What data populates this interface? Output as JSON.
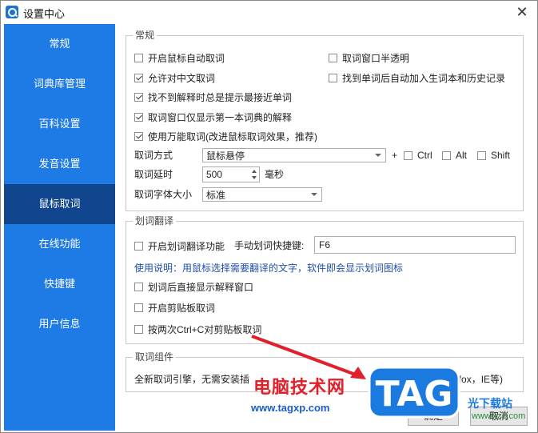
{
  "window": {
    "title": "设置中心",
    "close_glyph": "✕"
  },
  "sidebar": {
    "items": [
      {
        "label": "常规"
      },
      {
        "label": "词典库管理"
      },
      {
        "label": "百科设置"
      },
      {
        "label": "发音设置"
      },
      {
        "label": "鼠标取词",
        "active": true
      },
      {
        "label": "在线功能"
      },
      {
        "label": "快捷键"
      },
      {
        "label": "用户信息"
      }
    ]
  },
  "general": {
    "title": "常规",
    "opt_auto_pick": {
      "label": "开启鼠标自动取词",
      "checked": false
    },
    "opt_translucent": {
      "label": "取词窗口半透明",
      "checked": false
    },
    "opt_chinese": {
      "label": "允许对中文取词",
      "checked": true
    },
    "opt_add_history": {
      "label": "找到单词后自动加入生词本和历史记录",
      "checked": false
    },
    "opt_nearest": {
      "label": "找不到解释时总是提示最接近单词",
      "checked": true
    },
    "opt_first_dict": {
      "label": "取词窗口仅显示第一本词典的解释",
      "checked": true
    },
    "opt_universal": {
      "label": "使用万能取词(改进鼠标取词效果，推荐)",
      "checked": true
    },
    "mode_label": "取词方式",
    "mode_value": "鼠标悬停",
    "plus": "+",
    "ctrl": {
      "label": "Ctrl",
      "checked": false
    },
    "alt": {
      "label": "Alt",
      "checked": false
    },
    "shift": {
      "label": "Shift",
      "checked": false
    },
    "delay_label": "取词延时",
    "delay_value": "500",
    "delay_unit": "毫秒",
    "font_label": "取词字体大小",
    "font_value": "标准"
  },
  "translate": {
    "title": "划词翻译",
    "opt_enable": {
      "label": "开启划词翻译功能",
      "checked": false
    },
    "hotkey_label": "手动划词快捷键:",
    "hotkey_value": "F6",
    "note": "使用说明：用鼠标选择需要翻译的文字，软件即会显示划词图标",
    "opt_direct": {
      "label": "划词后直接显示解释窗口",
      "checked": false
    },
    "opt_clipboard": {
      "label": "开启剪贴板取词",
      "checked": false
    },
    "opt_ctrlc": {
      "label": "按两次Ctrl+C对剪贴板取词",
      "checked": false
    }
  },
  "component": {
    "title": "取词组件",
    "desc_left": "全新取词引擎，无需安装插",
    "desc_right": "hrome、Firefox，IE等)"
  },
  "buttons": {
    "ok": "确定",
    "cancel": "取消"
  },
  "watermark": {
    "text": "电脑技术网",
    "url": "www.tagxp.com",
    "logo": "TAG",
    "side": "光下载站",
    "side_url": "www.xz7.com"
  },
  "colors": {
    "sidebar": "#1e7be6",
    "sidebar_active": "#11468f",
    "note": "#1f4fa8"
  }
}
